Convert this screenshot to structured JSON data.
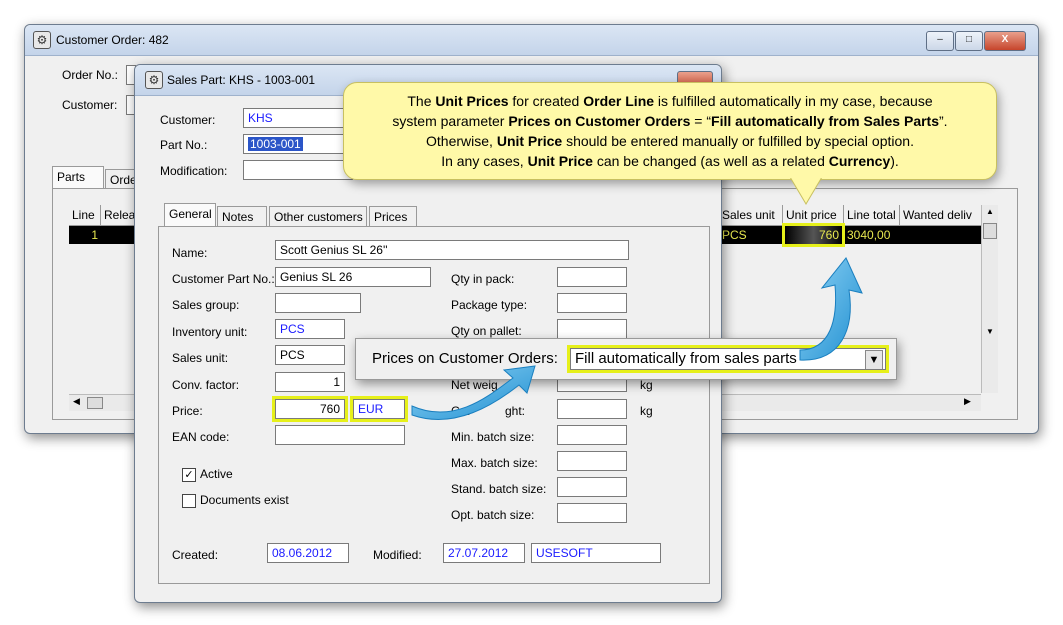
{
  "customer_order": {
    "title": "Customer Order: 482",
    "order_no_label": "Order No.:",
    "customer_label": "Customer:",
    "tabs": [
      "Parts",
      "Orde"
    ],
    "grid_left_headers": [
      "Line",
      "Relea"
    ],
    "grid_left_row": [
      "1",
      ""
    ],
    "grid_right_headers": [
      "Sales unit",
      "Unit price",
      "Line total",
      "Wanted deliv"
    ],
    "grid_right_row": [
      "PCS",
      "760",
      "3040,00",
      ""
    ],
    "min_label": "‒",
    "max_label": "□",
    "close_label": "X"
  },
  "sales_part": {
    "title": "Sales Part: KHS - 1003-001",
    "customer_label": "Customer:",
    "customer_value": "KHS",
    "part_no_label": "Part No.:",
    "part_no_value": "1003-001",
    "modification_label": "Modification:",
    "modification_value": "",
    "tabs": [
      "General",
      "Notes",
      "Other customers",
      "Prices"
    ],
    "name_label": "Name:",
    "name_value": "Scott Genius SL 26''",
    "customer_part_label": "Customer Part No.:",
    "customer_part_value": "Genius SL 26",
    "sales_group_label": "Sales group:",
    "sales_group_value": "",
    "inventory_unit_label": "Inventory unit:",
    "inventory_unit_value": "PCS",
    "sales_unit_label": "Sales unit:",
    "sales_unit_value": "PCS",
    "conv_factor_label": "Conv. factor:",
    "conv_factor_value": "1",
    "price_label": "Price:",
    "price_value": "760",
    "currency_value": "EUR",
    "ean_label": "EAN code:",
    "ean_value": "",
    "active_label": "Active",
    "documents_label": "Documents exist",
    "qty_in_pack_label": "Qty in pack:",
    "package_type_label": "Package type:",
    "qty_on_pallet_label": "Qty on pallet:",
    "net_weight_label": "Net weig",
    "gross_weight_label": "Gro",
    "gross_weight_label2": "ght:",
    "kg1": "kg",
    "kg2": "kg",
    "min_batch_label": "Min. batch size:",
    "max_batch_label": "Max. batch size:",
    "stand_batch_label": "Stand. batch size:",
    "opt_batch_label": "Opt. batch size:",
    "created_label": "Created:",
    "created_value": "08.06.2012",
    "modified_label": "Modified:",
    "modified_value": "27.07.2012",
    "modified_by_value": "USESOFT"
  },
  "param_popup": {
    "label": "Prices on Customer Orders:",
    "value": "Fill automatically from sales parts",
    "dropdown_icon": "▼"
  },
  "callout": {
    "l1_a": "The ",
    "l1_b": "Unit Prices",
    "l1_c": " for created ",
    "l1_d": "Order Line",
    "l1_e": " is fulfilled automatically in my case, because",
    "l2_a": "system parameter ",
    "l2_b": "Prices on Customer Orders",
    "l2_c": " = “",
    "l2_d": "Fill automatically from Sales Parts",
    "l2_e": "”.",
    "l3_a": "Otherwise, ",
    "l3_b": "Unit Price",
    "l3_c": " should be entered manually or fulfilled by special option.",
    "l4_a": "In any cases, ",
    "l4_b": "Unit Price",
    "l4_c": " can be changed (as well as a related ",
    "l4_d": "Currency",
    "l4_e": ")."
  },
  "colors": {
    "highlight": "#e6f01a",
    "arrow": "#3aa7e0",
    "callout_bg": "#fff9a8",
    "blue_text": "#1a1aff"
  }
}
